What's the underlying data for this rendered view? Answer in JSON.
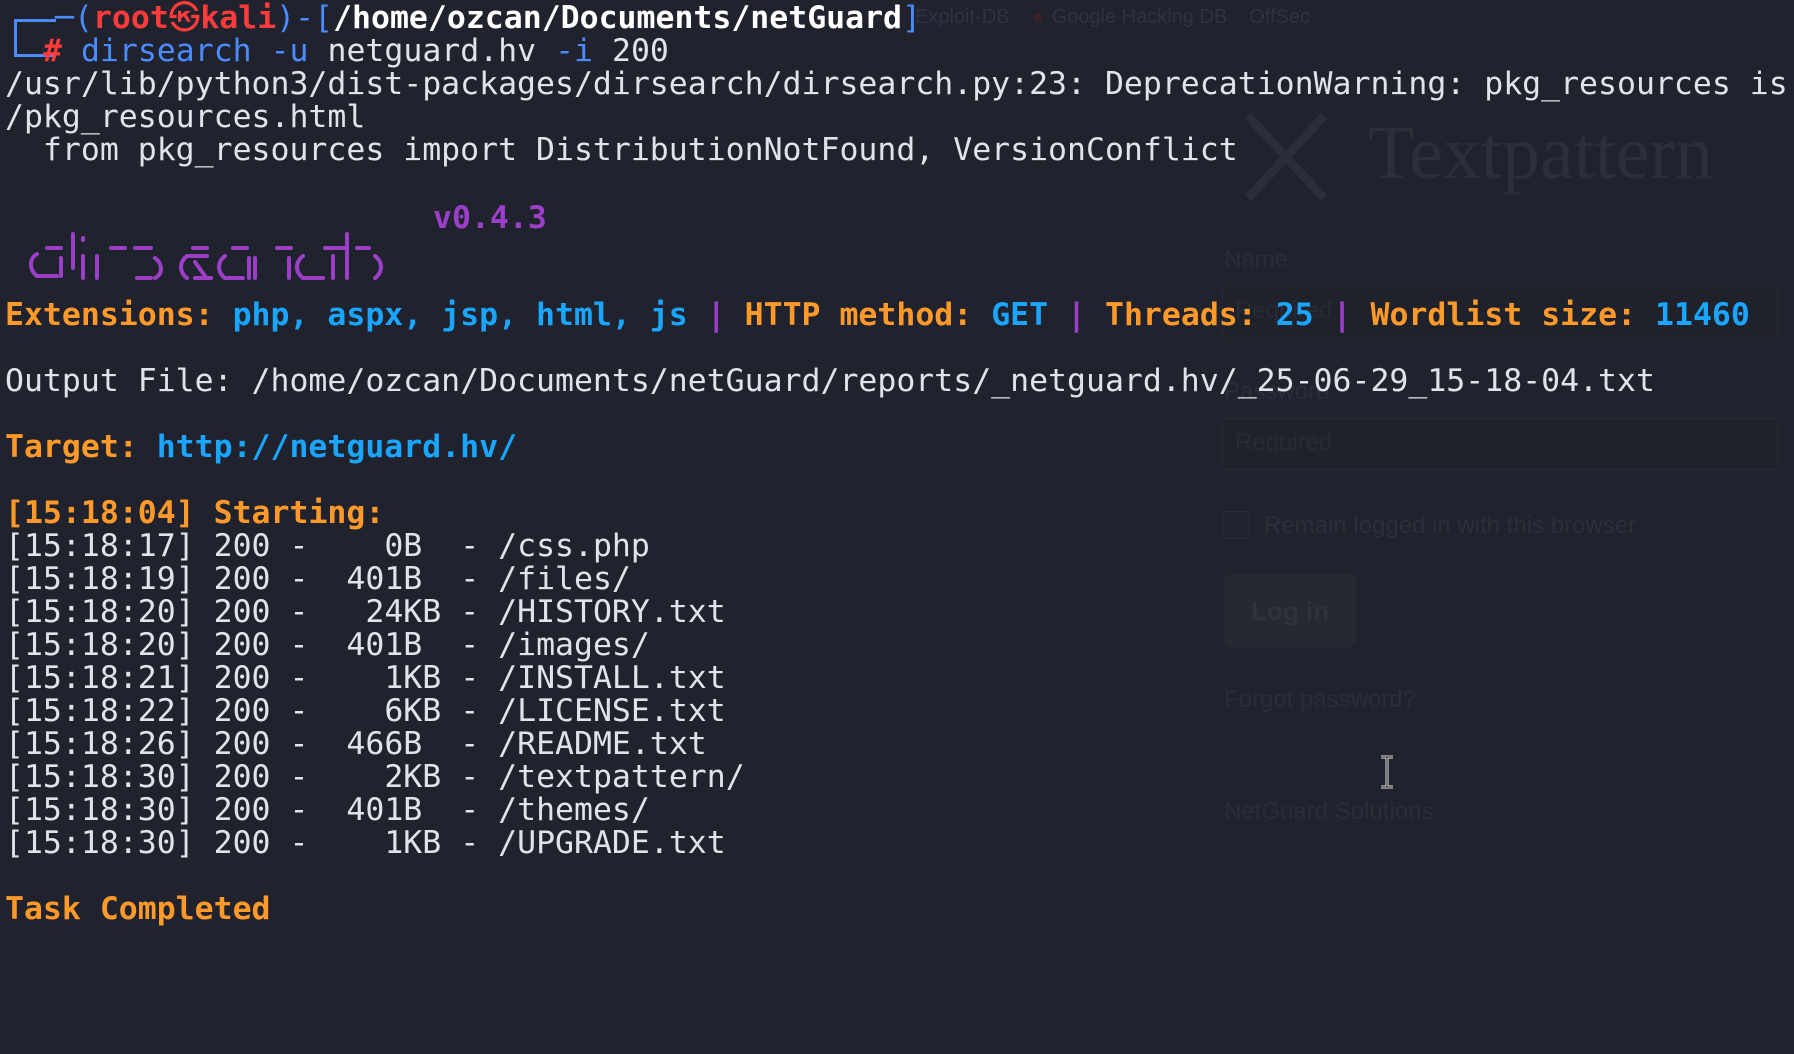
{
  "background_browser": {
    "bookmarks": [
      "Exploit-DB",
      "Google Hacking DB",
      "OffSec"
    ],
    "logo_text": "Textpattern",
    "name_label": "Name",
    "name_placeholder": "Required",
    "password_label": "Password",
    "password_placeholder": "Required",
    "remember_label": "Remain logged in with this browser",
    "login_button": "Log in",
    "forgot_link": "Forgot password?",
    "footer_link": "NetGuard Solutions"
  },
  "terminal": {
    "prompt": {
      "open": "┌──(",
      "user": "root",
      "at": "㉿",
      "host": "kali",
      "mid": ")-[",
      "path": "/home/ozcan/Documents/netGuard",
      "close": "]",
      "corner": "└─",
      "hash": "#",
      "command_name": "dirsearch",
      "command_args_1": "-u",
      "command_target": "netguard.hv",
      "command_args_2": "-i",
      "command_code": "200"
    },
    "warning_line_1": "/usr/lib/python3/dist-packages/dirsearch/dirsearch.py:23: DeprecationWarning: pkg_resources is",
    "warning_line_2": "/pkg_resources.html",
    "warning_line_3": "  from pkg_resources import DistributionNotFound, VersionConflict",
    "version": "v0.4.3",
    "config": {
      "extensions_label": "Extensions: ",
      "extensions_value": "php, aspx, jsp, html, js",
      "sep": " | ",
      "method_label": "HTTP method: ",
      "method_value": "GET",
      "threads_label": "Threads: ",
      "threads_value": "25",
      "wordlist_label": "Wordlist size: ",
      "wordlist_value": "11460"
    },
    "output_file": "Output File: /home/ozcan/Documents/netGuard/reports/_netguard.hv/_25-06-29_15-18-04.txt",
    "target_label": "Target: ",
    "target_url": "http://netguard.hv/",
    "starting_time": "[15:18:04]",
    "starting_label": " Starting:",
    "results": [
      {
        "time": "[15:18:17]",
        "code": "200",
        "size": "   0B ",
        "path": "/css.php"
      },
      {
        "time": "[15:18:19]",
        "code": "200",
        "size": " 401B ",
        "path": "/files/"
      },
      {
        "time": "[15:18:20]",
        "code": "200",
        "size": "  24KB",
        "path": "/HISTORY.txt"
      },
      {
        "time": "[15:18:20]",
        "code": "200",
        "size": " 401B ",
        "path": "/images/"
      },
      {
        "time": "[15:18:21]",
        "code": "200",
        "size": "   1KB",
        "path": "/INSTALL.txt"
      },
      {
        "time": "[15:18:22]",
        "code": "200",
        "size": "   6KB",
        "path": "/LICENSE.txt"
      },
      {
        "time": "[15:18:26]",
        "code": "200",
        "size": " 466B ",
        "path": "/README.txt"
      },
      {
        "time": "[15:18:30]",
        "code": "200",
        "size": "   2KB",
        "path": "/textpattern/"
      },
      {
        "time": "[15:18:30]",
        "code": "200",
        "size": " 401B ",
        "path": "/themes/"
      },
      {
        "time": "[15:18:30]",
        "code": "200",
        "size": "   1KB",
        "path": "/UPGRADE.txt"
      }
    ],
    "task_completed": "Task Completed"
  },
  "colors": {
    "background": "#20232d",
    "prompt_blue": "#4a8cff",
    "prompt_red": "#ff3b3b",
    "orange": "#ff9a2a",
    "light_blue": "#1aa5ff",
    "purple": "#9b3fc8",
    "text": "#dfe3ea"
  },
  "icons": [
    "text-cursor-icon",
    "textpattern-logo-icon",
    "bookmark-favicon"
  ]
}
